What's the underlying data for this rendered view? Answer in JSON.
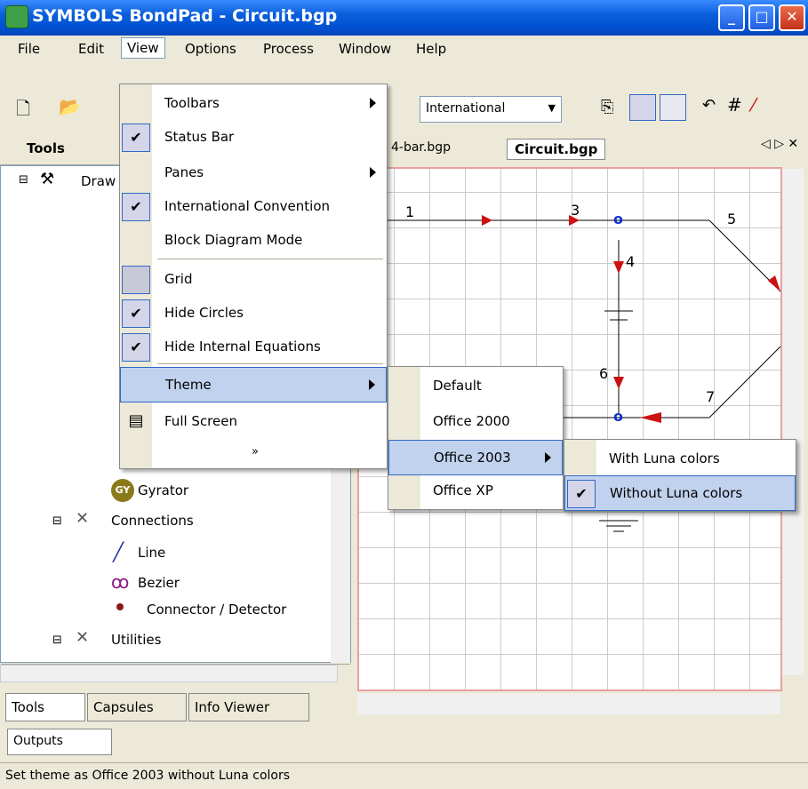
{
  "window": {
    "title": "SYMBOLS BondPad - Circuit.bgp"
  },
  "menubar": [
    "File",
    "Edit",
    "View",
    "Options",
    "Process",
    "Window",
    "Help"
  ],
  "toolbar": {
    "convention": "International"
  },
  "tools_pane": {
    "title": "Tools",
    "root": "Draw",
    "gyrator": "Gyrator",
    "badge": "GY",
    "connections": "Connections",
    "line": "Line",
    "bezier": "Bezier",
    "connector": "Connector / Detector",
    "utilities": "Utilities",
    "tabs": [
      "Tools",
      "Capsules",
      "Info Viewer"
    ]
  },
  "doc_tabs": [
    "4-bar.bgp",
    "Circuit.bgp"
  ],
  "view_menu": {
    "items": [
      {
        "label": "Toolbars"
      },
      {
        "label": "Status Bar"
      },
      {
        "label": "Panes"
      },
      {
        "label": "International Convention"
      },
      {
        "label": "Block Diagram Mode"
      },
      {
        "label": "Grid"
      },
      {
        "label": "Hide Circles"
      },
      {
        "label": "Hide Internal Equations"
      },
      {
        "label": "Theme"
      },
      {
        "label": "Full Screen"
      }
    ]
  },
  "theme_menu": [
    "Default",
    "Office 2000",
    "Office 2003",
    "Office XP"
  ],
  "office2003_menu": [
    "With Luna colors",
    "Without Luna colors"
  ],
  "diagram_labels": [
    "1",
    "3",
    "4",
    "5",
    "6",
    "7"
  ],
  "outputs": "Outputs",
  "status": "Set theme as Office 2003 without Luna colors",
  "colors": {
    "titlebar": "#0054e3",
    "highlight": "#c1d2ee",
    "wire_red": "#cc1111",
    "node_blue": "#1133cc"
  }
}
